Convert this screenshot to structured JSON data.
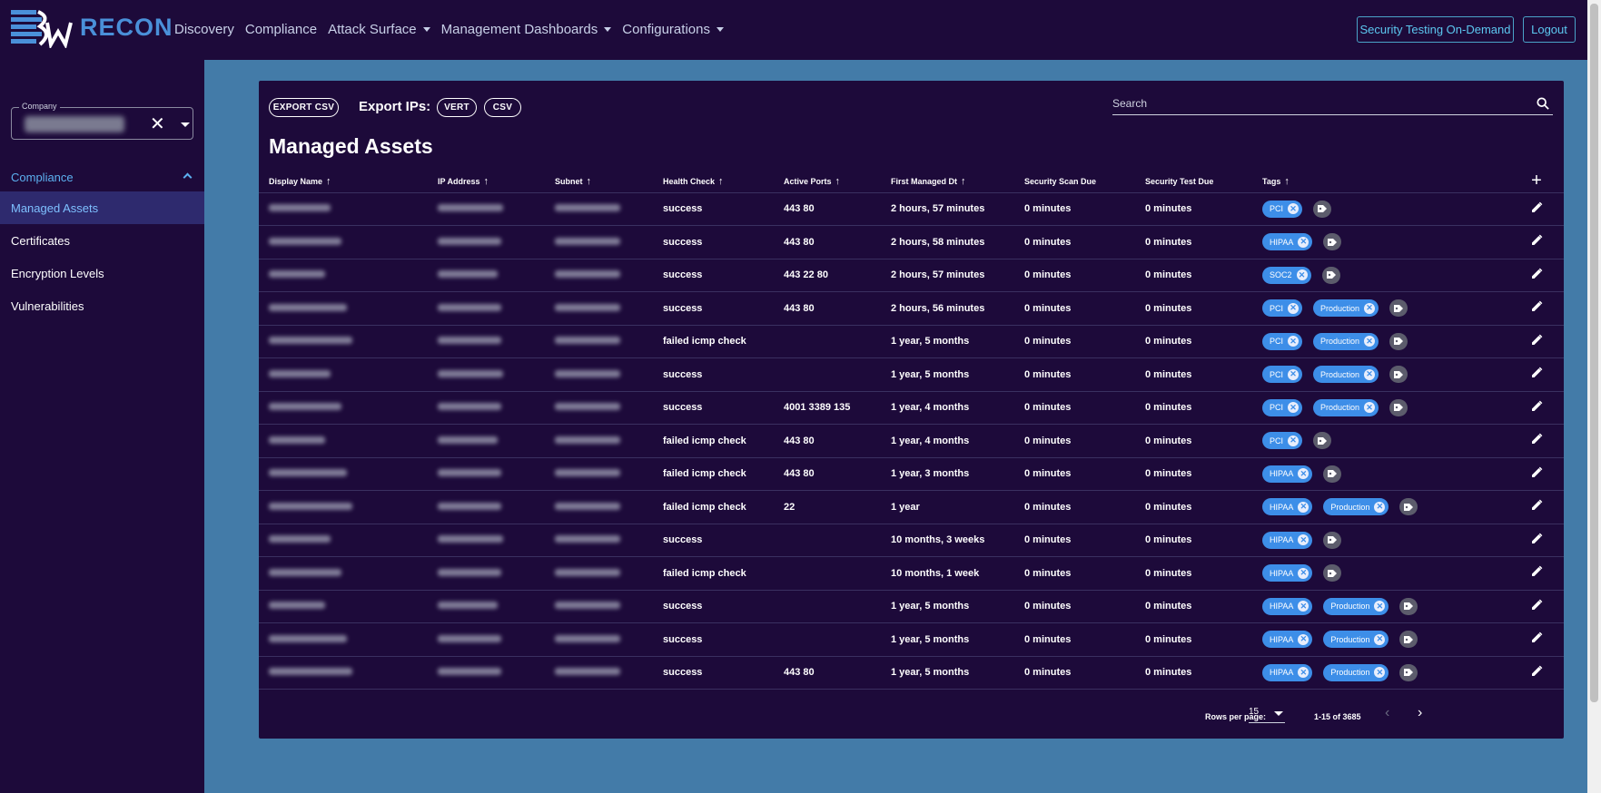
{
  "app": {
    "logo_text": "RECON"
  },
  "nav": {
    "items": [
      {
        "label": "Discovery",
        "has_menu": false
      },
      {
        "label": "Compliance",
        "has_menu": false
      },
      {
        "label": "Attack Surface",
        "has_menu": true
      },
      {
        "label": "Management Dashboards",
        "has_menu": true
      },
      {
        "label": "Configurations",
        "has_menu": true
      }
    ],
    "security_testing_button": "Security Testing On-Demand",
    "logout_button": "Logout"
  },
  "sidebar": {
    "company_label": "Company",
    "section": "Compliance",
    "items": [
      {
        "label": "Managed Assets",
        "active": true
      },
      {
        "label": "Certificates",
        "active": false
      },
      {
        "label": "Encryption Levels",
        "active": false
      },
      {
        "label": "Vulnerabilities",
        "active": false
      }
    ]
  },
  "toolbar": {
    "export_csv": "EXPORT CSV",
    "export_ips_label": "Export IPs:",
    "vert_button": "VERT",
    "csv_button": "CSV",
    "search_placeholder": "Search"
  },
  "page_title": "Managed Assets",
  "table": {
    "columns": [
      "Display Name",
      "IP Address",
      "Subnet",
      "Health Check",
      "Active Ports",
      "First Managed Dt",
      "Security Scan Due",
      "Security Test Due",
      "Tags"
    ],
    "rows": [
      {
        "health": "success",
        "ports": "443 80",
        "first_managed": "2 hours, 57 minutes",
        "scan_due": "0 minutes",
        "test_due": "0 minutes",
        "tags": [
          "PCI"
        ]
      },
      {
        "health": "success",
        "ports": "443 80",
        "first_managed": "2 hours, 58 minutes",
        "scan_due": "0 minutes",
        "test_due": "0 minutes",
        "tags": [
          "HIPAA"
        ]
      },
      {
        "health": "success",
        "ports": "443 22 80",
        "first_managed": "2 hours, 57 minutes",
        "scan_due": "0 minutes",
        "test_due": "0 minutes",
        "tags": [
          "SOC2"
        ]
      },
      {
        "health": "success",
        "ports": "443 80",
        "first_managed": "2 hours, 56 minutes",
        "scan_due": "0 minutes",
        "test_due": "0 minutes",
        "tags": [
          "PCI",
          "Production"
        ]
      },
      {
        "health": "failed icmp check",
        "ports": "",
        "first_managed": "1 year, 5 months",
        "scan_due": "0 minutes",
        "test_due": "0 minutes",
        "tags": [
          "PCI",
          "Production"
        ]
      },
      {
        "health": "success",
        "ports": "",
        "first_managed": "1 year, 5 months",
        "scan_due": "0 minutes",
        "test_due": "0 minutes",
        "tags": [
          "PCI",
          "Production"
        ]
      },
      {
        "health": "success",
        "ports": "4001 3389 135",
        "first_managed": "1 year, 4 months",
        "scan_due": "0 minutes",
        "test_due": "0 minutes",
        "tags": [
          "PCI",
          "Production"
        ]
      },
      {
        "health": "failed icmp check",
        "ports": "443 80",
        "first_managed": "1 year, 4 months",
        "scan_due": "0 minutes",
        "test_due": "0 minutes",
        "tags": [
          "PCI"
        ]
      },
      {
        "health": "failed icmp check",
        "ports": "443 80",
        "first_managed": "1 year, 3 months",
        "scan_due": "0 minutes",
        "test_due": "0 minutes",
        "tags": [
          "HIPAA"
        ]
      },
      {
        "health": "failed icmp check",
        "ports": "22",
        "first_managed": "1 year",
        "scan_due": "0 minutes",
        "test_due": "0 minutes",
        "tags": [
          "HIPAA",
          "Production"
        ]
      },
      {
        "health": "success",
        "ports": "",
        "first_managed": "10 months, 3 weeks",
        "scan_due": "0 minutes",
        "test_due": "0 minutes",
        "tags": [
          "HIPAA"
        ]
      },
      {
        "health": "failed icmp check",
        "ports": "",
        "first_managed": "10 months, 1 week",
        "scan_due": "0 minutes",
        "test_due": "0 minutes",
        "tags": [
          "HIPAA"
        ]
      },
      {
        "health": "success",
        "ports": "",
        "first_managed": "1 year, 5 months",
        "scan_due": "0 minutes",
        "test_due": "0 minutes",
        "tags": [
          "HIPAA",
          "Production"
        ]
      },
      {
        "health": "success",
        "ports": "",
        "first_managed": "1 year, 5 months",
        "scan_due": "0 minutes",
        "test_due": "0 minutes",
        "tags": [
          "HIPAA",
          "Production"
        ]
      },
      {
        "health": "success",
        "ports": "443 80",
        "first_managed": "1 year, 5 months",
        "scan_due": "0 minutes",
        "test_due": "0 minutes",
        "tags": [
          "HIPAA",
          "Production"
        ]
      }
    ]
  },
  "pagination": {
    "rows_per_page_label": "Rows per page:",
    "rows_per_page": "15",
    "range": "1-15 of 3685"
  },
  "colors": {
    "background": "#1d0a3a",
    "main_bg": "#437ba8",
    "accent": "#3d8ee8",
    "link": "#5cc8f0"
  }
}
